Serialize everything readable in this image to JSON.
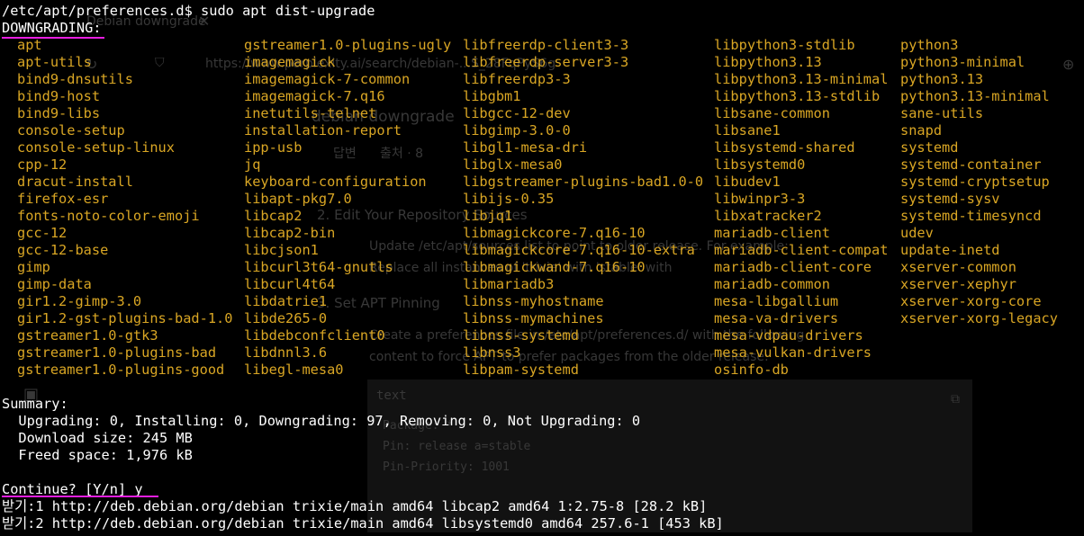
{
  "terminal": {
    "command_line": "/etc/apt/preferences.d$ sudo apt dist-upgrade",
    "downgrading_header": "DOWNGRADING:",
    "packages": [
      [
        "apt",
        "apt-utils",
        "bind9-dnsutils",
        "bind9-host",
        "bind9-libs",
        "console-setup",
        "console-setup-linux",
        "cpp-12",
        "dracut-install",
        "firefox-esr",
        "fonts-noto-color-emoji",
        "gcc-12",
        "gcc-12-base",
        "gimp",
        "gimp-data",
        "gir1.2-gimp-3.0",
        "gir1.2-gst-plugins-bad-1.0",
        "gstreamer1.0-gtk3",
        "gstreamer1.0-plugins-bad",
        "gstreamer1.0-plugins-good"
      ],
      [
        "gstreamer1.0-plugins-ugly",
        "imagemagick",
        "imagemagick-7-common",
        "imagemagick-7.q16",
        "inetutils-telnet",
        "installation-report",
        "ipp-usb",
        "jq",
        "keyboard-configuration",
        "libapt-pkg7.0",
        "libcap2",
        "libcap2-bin",
        "libcjson1",
        "libcurl3t64-gnutls",
        "libcurl4t64",
        "libdatrie1",
        "libde265-0",
        "libdebconfclient0",
        "libdnnl3.6",
        "libegl-mesa0"
      ],
      [
        "libfreerdp-client3-3",
        "libfreerdp-server3-3",
        "libfreerdp3-3",
        "libgbm1",
        "libgcc-12-dev",
        "libgimp-3.0-0",
        "libgl1-mesa-dri",
        "libglx-mesa0",
        "libgstreamer-plugins-bad1.0-0",
        "libijs-0.35",
        "libjq1",
        "libmagickcore-7.q16-10",
        "libmagickcore-7.q16-10-extra",
        "libmagickwand-7.q16-10",
        "libmariadb3",
        "libnss-myhostname",
        "libnss-mymachines",
        "libnss-systemd",
        "libnss3",
        "libpam-systemd"
      ],
      [
        "libpython3-stdlib",
        "libpython3.13",
        "libpython3.13-minimal",
        "libpython3.13-stdlib",
        "libsane-common",
        "libsane1",
        "libsystemd-shared",
        "libsystemd0",
        "libudev1",
        "libwinpr3-3",
        "libxatracker2",
        "mariadb-client",
        "mariadb-client-compat",
        "mariadb-client-core",
        "mariadb-common",
        "mesa-libgallium",
        "mesa-va-drivers",
        "mesa-vdpau-drivers",
        "mesa-vulkan-drivers",
        "osinfo-db"
      ],
      [
        "python3",
        "python3-minimal",
        "python3.13",
        "python3.13-minimal",
        "sane-utils",
        "snapd",
        "systemd",
        "systemd-container",
        "systemd-cryptsetup",
        "systemd-sysv",
        "systemd-timesyncd",
        "udev",
        "update-inetd",
        "xserver-common",
        "xserver-xephyr",
        "xserver-xorg-core",
        "xserver-xorg-legacy"
      ]
    ],
    "summary_header": "Summary:",
    "summary_counts": "  Upgrading: 0, Installing: 0, Downgrading: 97, Removing: 0, Not Upgrading: 0",
    "download_size": "  Download size: 245 MB",
    "freed_space": "  Freed space: 1,976 kB",
    "continue_prompt": "Continue? [Y/n] y",
    "fetch_lines": [
      "받기:1 http://deb.debian.org/debian trixie/main amd64 libcap2 amd64 1:2.75-8 [28.2 kB]",
      "받기:2 http://deb.debian.org/debian trixie/main amd64 libsystemd0 amd64 257.6-1 [453 kB]"
    ]
  },
  "background_ghost": {
    "tab_title": "Debian downgrade",
    "url": "https://www.perplexity.ai/search/debian-...S_28FqPyS6g",
    "heading": "debian downgrade",
    "tab_answer": "답변",
    "tab_sources": "출처 · 8",
    "step2_title": "2. Edit Your Repository Sources",
    "bullet1": "Update /etc/apt/sources.list to point to older release. For example:",
    "bullet1b": "Replace all instances of 'trixie' with 'stable' with",
    "step3_title": "3. Set APT Pinning",
    "step3_text1": "Create a preferences file in /etc/apt/preferences.d/ with the following",
    "step3_text2": "content to force APT to prefer packages from the older release:",
    "code_label": "text",
    "code_lines": [
      "Package: *",
      "Pin: release a=stable",
      "Pin-Priority: 1001"
    ]
  },
  "colors": {
    "background": "#000000",
    "text": "#ffffff",
    "package": "#d9a624",
    "underline": "#e81ee0"
  }
}
